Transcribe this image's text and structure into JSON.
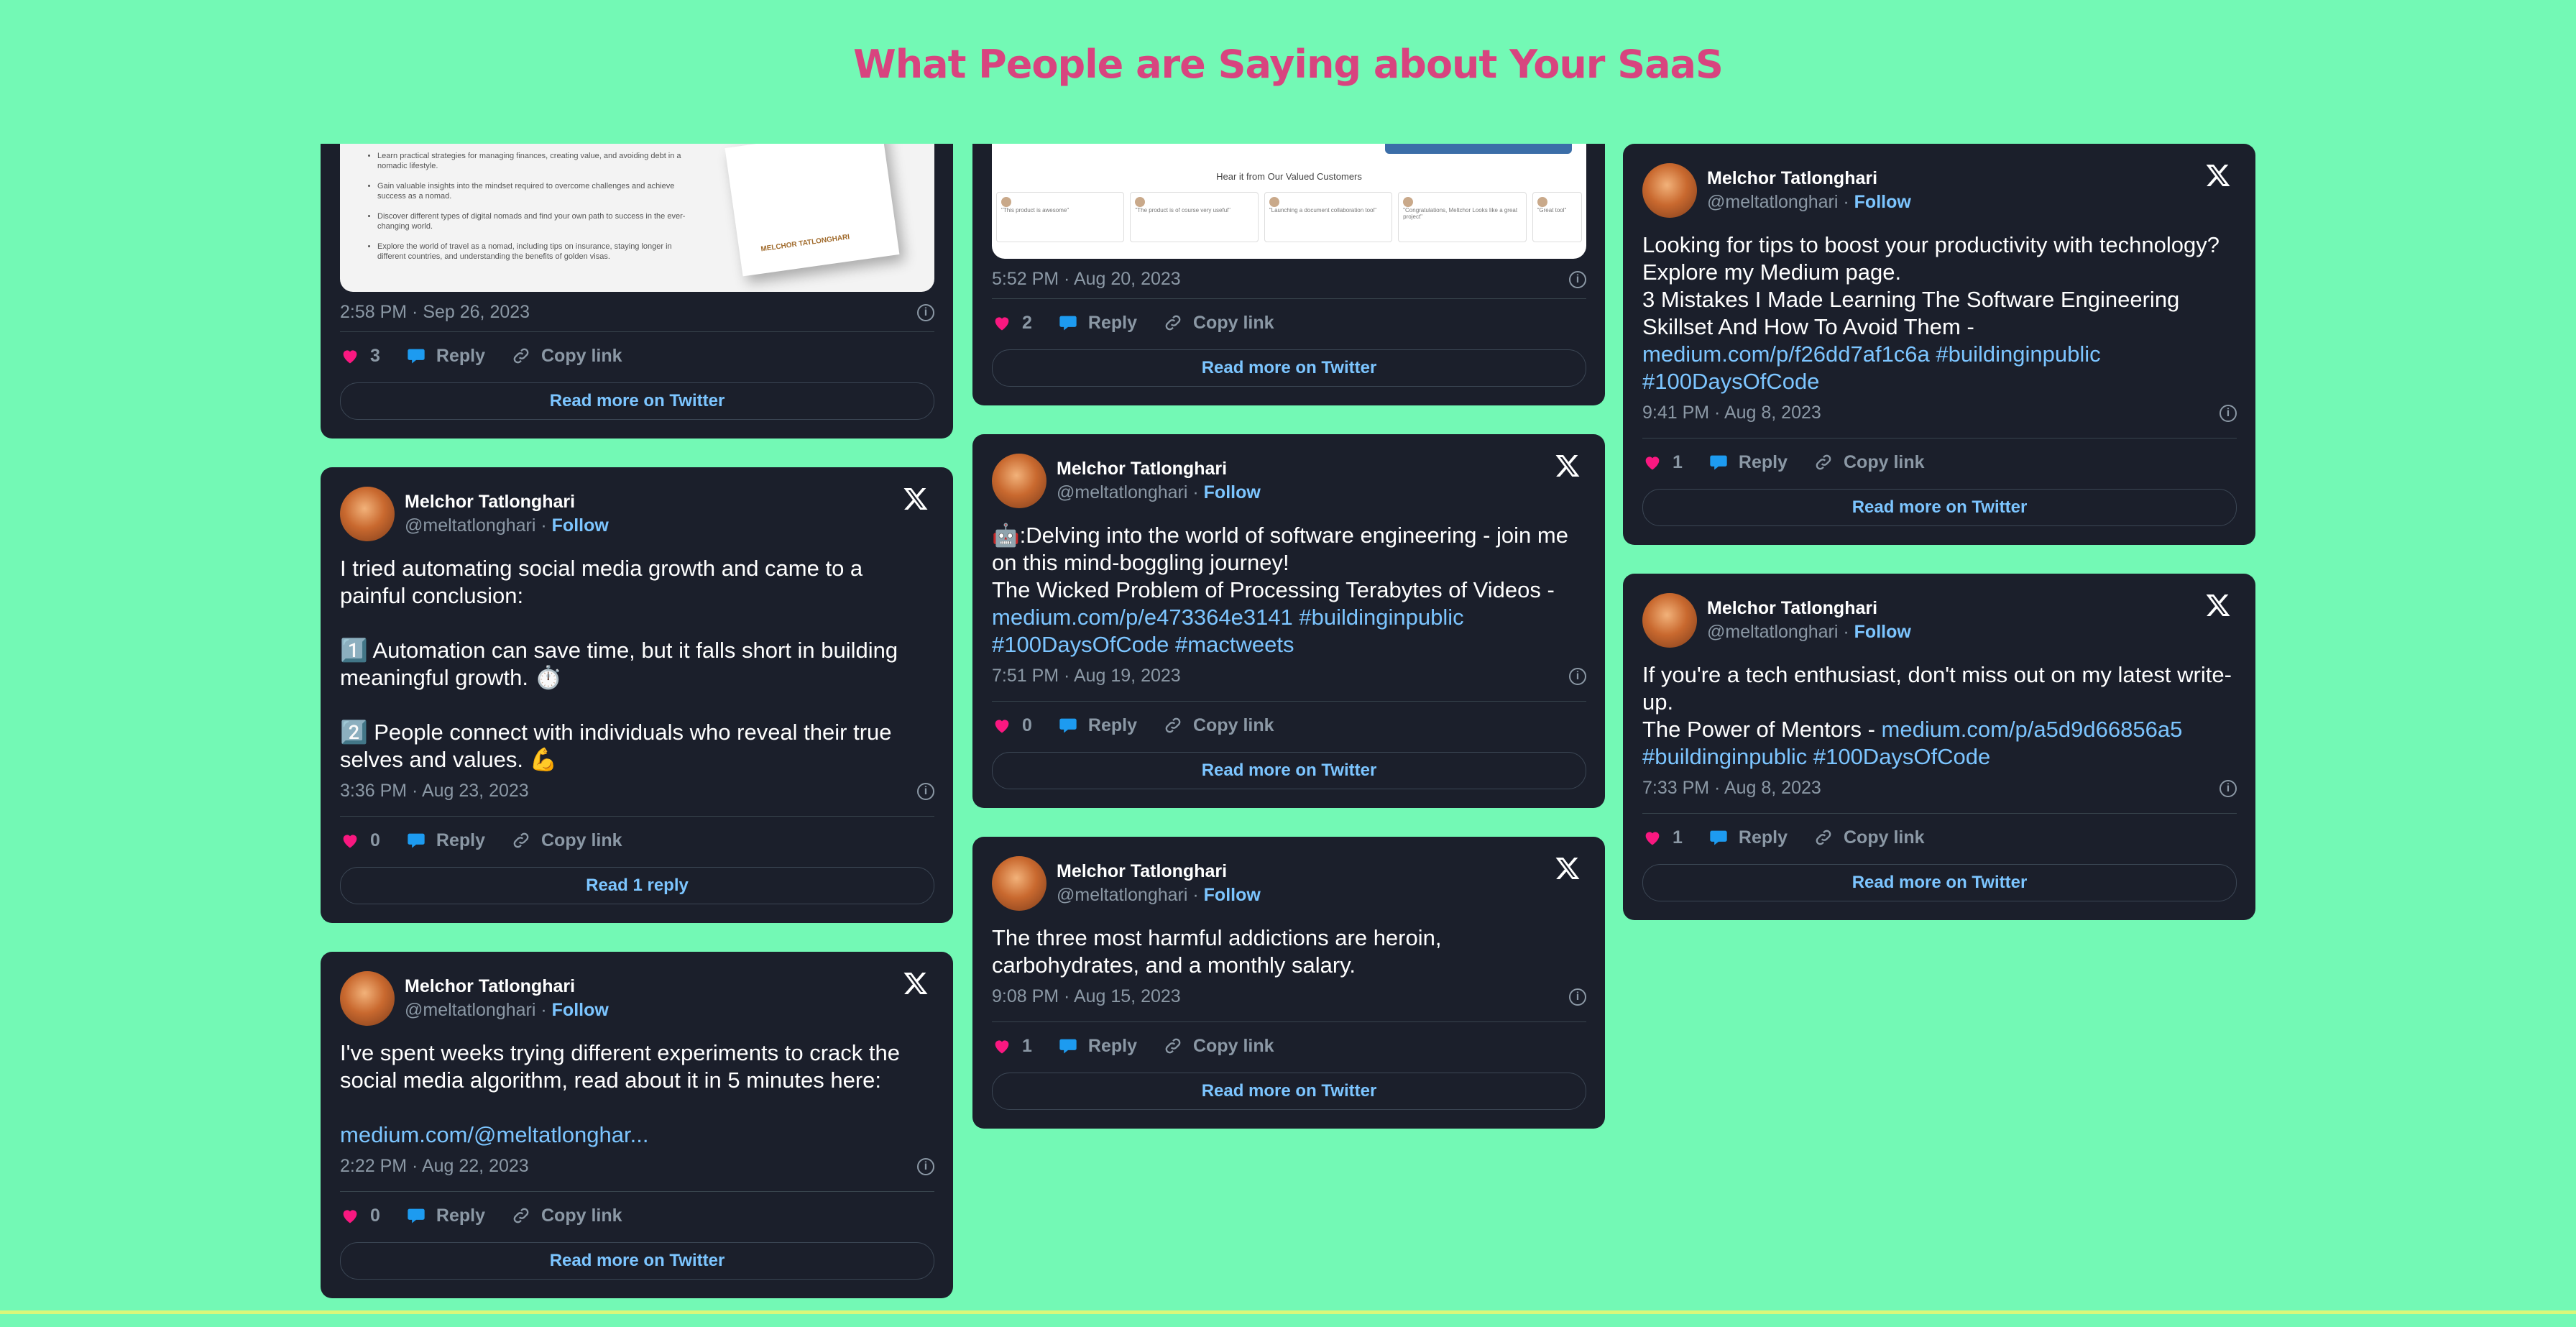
{
  "page": {
    "title": "What People are Saying about Your SaaS"
  },
  "common": {
    "name": "Melchor Tatlonghari",
    "handle": "@meltatlonghari",
    "dot": "·",
    "follow": "Follow",
    "reply": "Reply",
    "copy_link": "Copy link"
  },
  "book_preview": {
    "bullets": [
      "Learn practical strategies for managing finances, creating value, and avoiding debt in a nomadic lifestyle.",
      "Gain valuable insights into the mindset required to overcome challenges and achieve success as a nomad.",
      "Discover different types of digital nomads and find your own path to success in the ever-changing world.",
      "Explore the world of travel as a nomad, including tips on insurance, staying longer in different countries, and understanding the benefits of golden visas."
    ],
    "cover_text": "MELCHOR TATLONGHARI"
  },
  "web_preview": {
    "title": "Hear it from Our Valued Customers",
    "testimonials": [
      "\"This product is awesome\"",
      "\"The product is of course very useful\"",
      "\"Launching a document collaboration tool\"",
      "\"Congratulations, Meltchor Looks like a great project\"",
      "\"Great tool\""
    ]
  },
  "tweets": {
    "t1": {
      "time": "2:58 PM · Sep 26, 2023",
      "likes": "3",
      "cta": "Read more on Twitter"
    },
    "t2": {
      "p1": "I tried automating social media growth and came to a painful conclusion:",
      "p2": "1️⃣ Automation can save time, but it falls short in building meaningful growth. ⏱️",
      "p3": "2️⃣ People connect with individuals who reveal their true selves and values. 💪",
      "time": "3:36 PM · Aug 23, 2023",
      "likes": "0",
      "cta": "Read 1 reply"
    },
    "t3": {
      "p1": "I've spent weeks trying different experiments to crack the social media algorithm, read about it in 5 minutes here:",
      "link": "medium.com/@meltatlonghar...",
      "time": "2:22 PM · Aug 22, 2023",
      "likes": "0",
      "cta": "Read more on Twitter"
    },
    "t4": {
      "time": "5:52 PM · Aug 20, 2023",
      "likes": "2",
      "cta": "Read more on Twitter"
    },
    "t5": {
      "line1": "🤖:Delving into the world of software engineering - join me on this mind-boggling journey!",
      "line2": "The Wicked Problem of Processing Terabytes of Videos -",
      "links": "medium.com/p/e473364e3141 #buildinginpublic #100DaysOfCode #mactweets",
      "time": "7:51 PM · Aug 19, 2023",
      "likes": "0",
      "cta": "Read more on Twitter"
    },
    "t6": {
      "p1": "The three most harmful addictions are heroin, carbohydrates, and a monthly salary.",
      "time": "9:08 PM · Aug 15, 2023",
      "likes": "1",
      "cta": "Read more on Twitter"
    },
    "t7": {
      "line1": "Looking for tips to boost your productivity with technology? Explore my Medium page.",
      "line2": "3 Mistakes I Made Learning The Software Engineering Skillset And How To Avoid Them -",
      "links": "medium.com/p/f26dd7af1c6a #buildinginpublic #100DaysOfCode",
      "time": "9:41 PM · Aug 8, 2023",
      "likes": "1",
      "cta": "Read more on Twitter"
    },
    "t8": {
      "line1": "If you're a tech enthusiast, don't miss out on my latest write-up.",
      "line2": "The Power of Mentors - ",
      "links_inline": "medium.com/p/a5d9d66856a5",
      "links": "#buildinginpublic #100DaysOfCode",
      "time": "7:33 PM · Aug 8, 2023",
      "likes": "1",
      "cta": "Read more on Twitter"
    }
  }
}
